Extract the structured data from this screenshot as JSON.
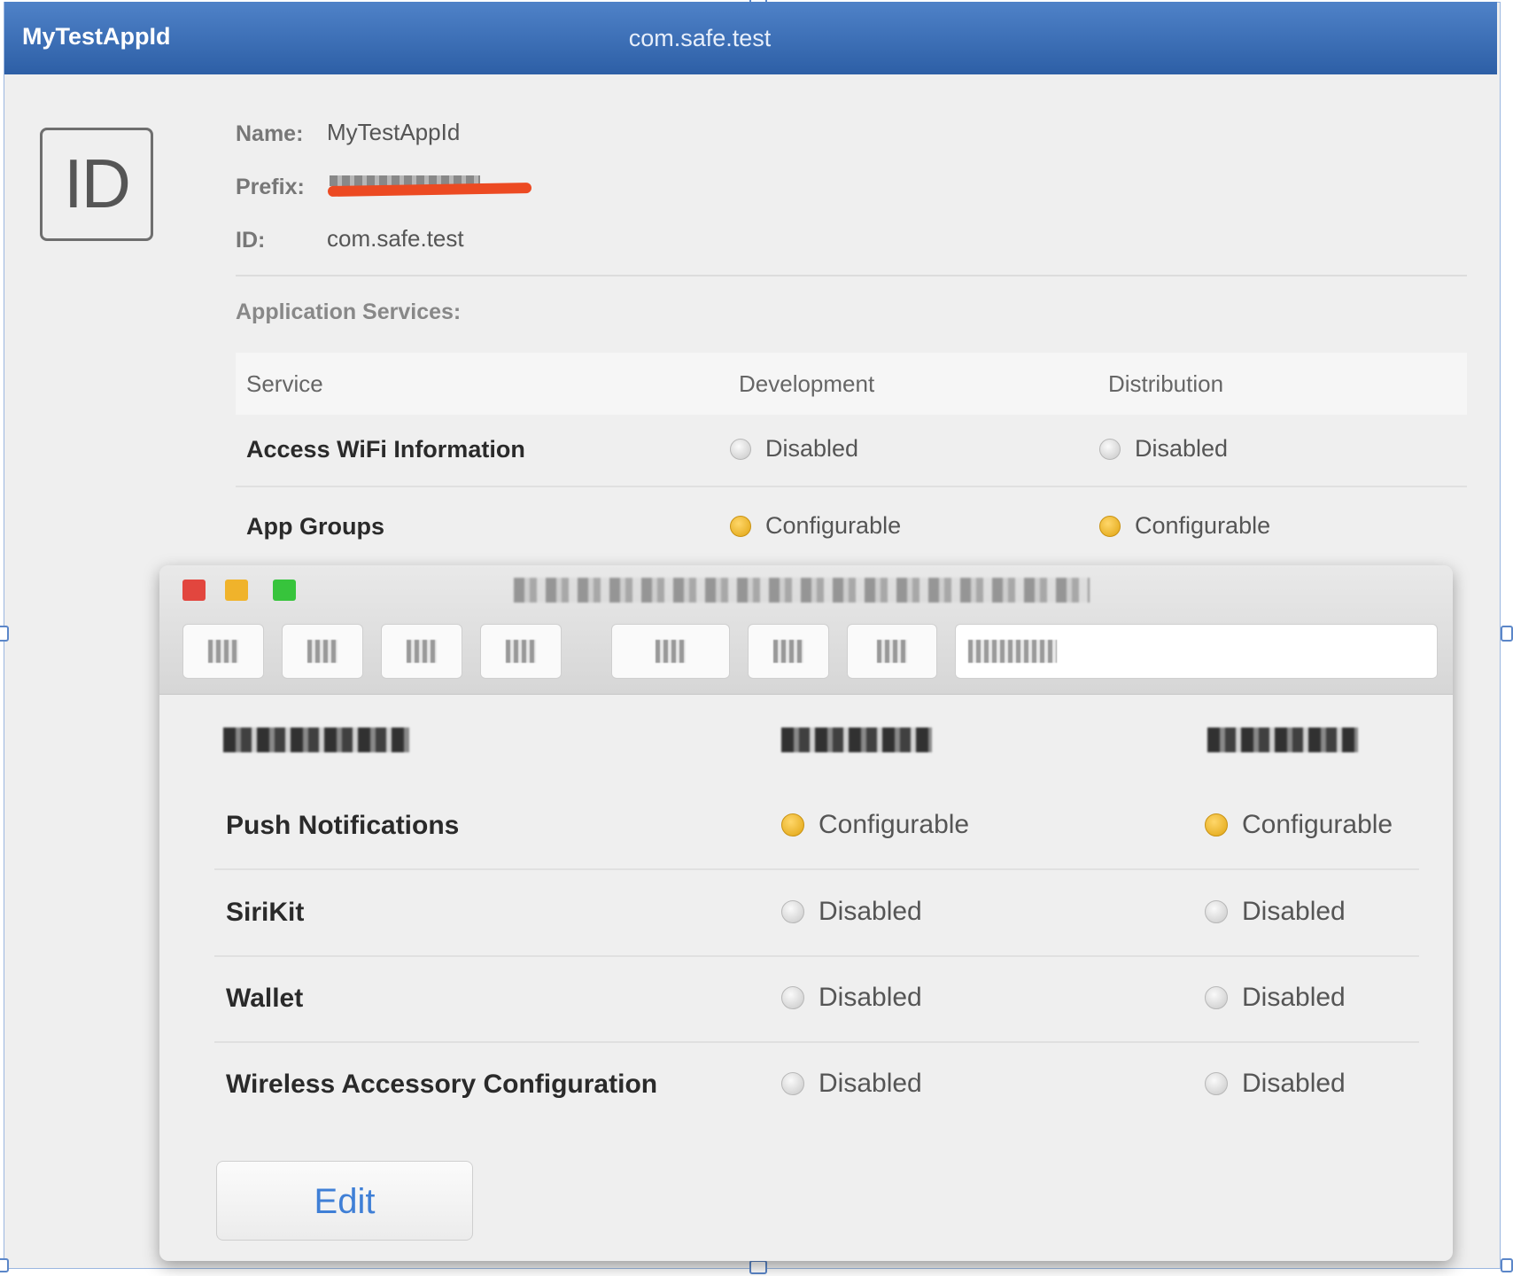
{
  "titlebar": {
    "app_name": "MyTestAppId",
    "bundle_id": "com.safe.test"
  },
  "badge": {
    "label": "ID"
  },
  "info": {
    "name_label": "Name:",
    "name_value": "MyTestAppId",
    "prefix_label": "Prefix:",
    "id_label": "ID:",
    "id_value": "com.safe.test"
  },
  "services": {
    "section_title": "Application Services:",
    "columns": [
      "Service",
      "Development",
      "Distribution"
    ],
    "rows_top": [
      {
        "service": "Access WiFi Information",
        "development": "Disabled",
        "distribution": "Disabled",
        "dev_color": "gray",
        "dist_color": "gray"
      },
      {
        "service": "App Groups",
        "development": "Configurable",
        "distribution": "Configurable",
        "dev_color": "yellow",
        "dist_color": "yellow"
      }
    ],
    "rows_bottom": [
      {
        "service": "Push Notifications",
        "development": "Configurable",
        "distribution": "Configurable",
        "dev_color": "yellow",
        "dist_color": "yellow"
      },
      {
        "service": "SiriKit",
        "development": "Disabled",
        "distribution": "Disabled",
        "dev_color": "gray",
        "dist_color": "gray"
      },
      {
        "service": "Wallet",
        "development": "Disabled",
        "distribution": "Disabled",
        "dev_color": "gray",
        "dist_color": "gray"
      },
      {
        "service": "Wireless Accessory Configuration",
        "development": "Disabled",
        "distribution": "Disabled",
        "dev_color": "gray",
        "dist_color": "gray"
      }
    ]
  },
  "window": {
    "traffic_colors": [
      "#e2463e",
      "#f0b32b",
      "#37c43c"
    ],
    "toolbar_icons": [
      "blurred-icon",
      "blurred-icon",
      "blurred-icon",
      "blurred-icon",
      "blurred-icon",
      "blurred-icon",
      "blurred-icon"
    ]
  },
  "edit_label": "Edit",
  "colors": {
    "titlebar": "#3a6db5",
    "accent": "#3f7fd6",
    "configurable": "#e8ac1c",
    "disabled": "#c7c7c7"
  }
}
